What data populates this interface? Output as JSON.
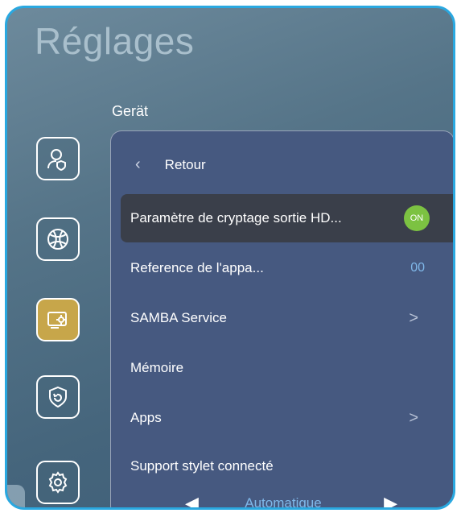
{
  "app": {
    "title": "Réglages"
  },
  "section": {
    "label": "Gerät"
  },
  "sidebar": {
    "items": [
      {
        "icon": "user-shield-icon",
        "active": false
      },
      {
        "icon": "globe-icon",
        "active": false
      },
      {
        "icon": "device-settings-icon",
        "active": true
      },
      {
        "icon": "security-icon",
        "active": false
      },
      {
        "icon": "gear-icon",
        "active": false
      }
    ]
  },
  "panel": {
    "back_label": "Retour",
    "rows": [
      {
        "label": "Paramètre de cryptage sortie HD...",
        "toggle": "ON"
      },
      {
        "label": "Reference de l'appa...",
        "value": "00"
      },
      {
        "label": "SAMBA Service",
        "arrow": ">"
      },
      {
        "label": "Mémoire"
      },
      {
        "label": "Apps",
        "arrow": ">"
      },
      {
        "label": "Support stylet connecté"
      }
    ],
    "bottom_value": "Automatique"
  },
  "colors": {
    "accent": "#c7a64a",
    "toggle_on": "#7cc242",
    "value_text": "#7fb7e8",
    "panel_bg": "#465980"
  }
}
